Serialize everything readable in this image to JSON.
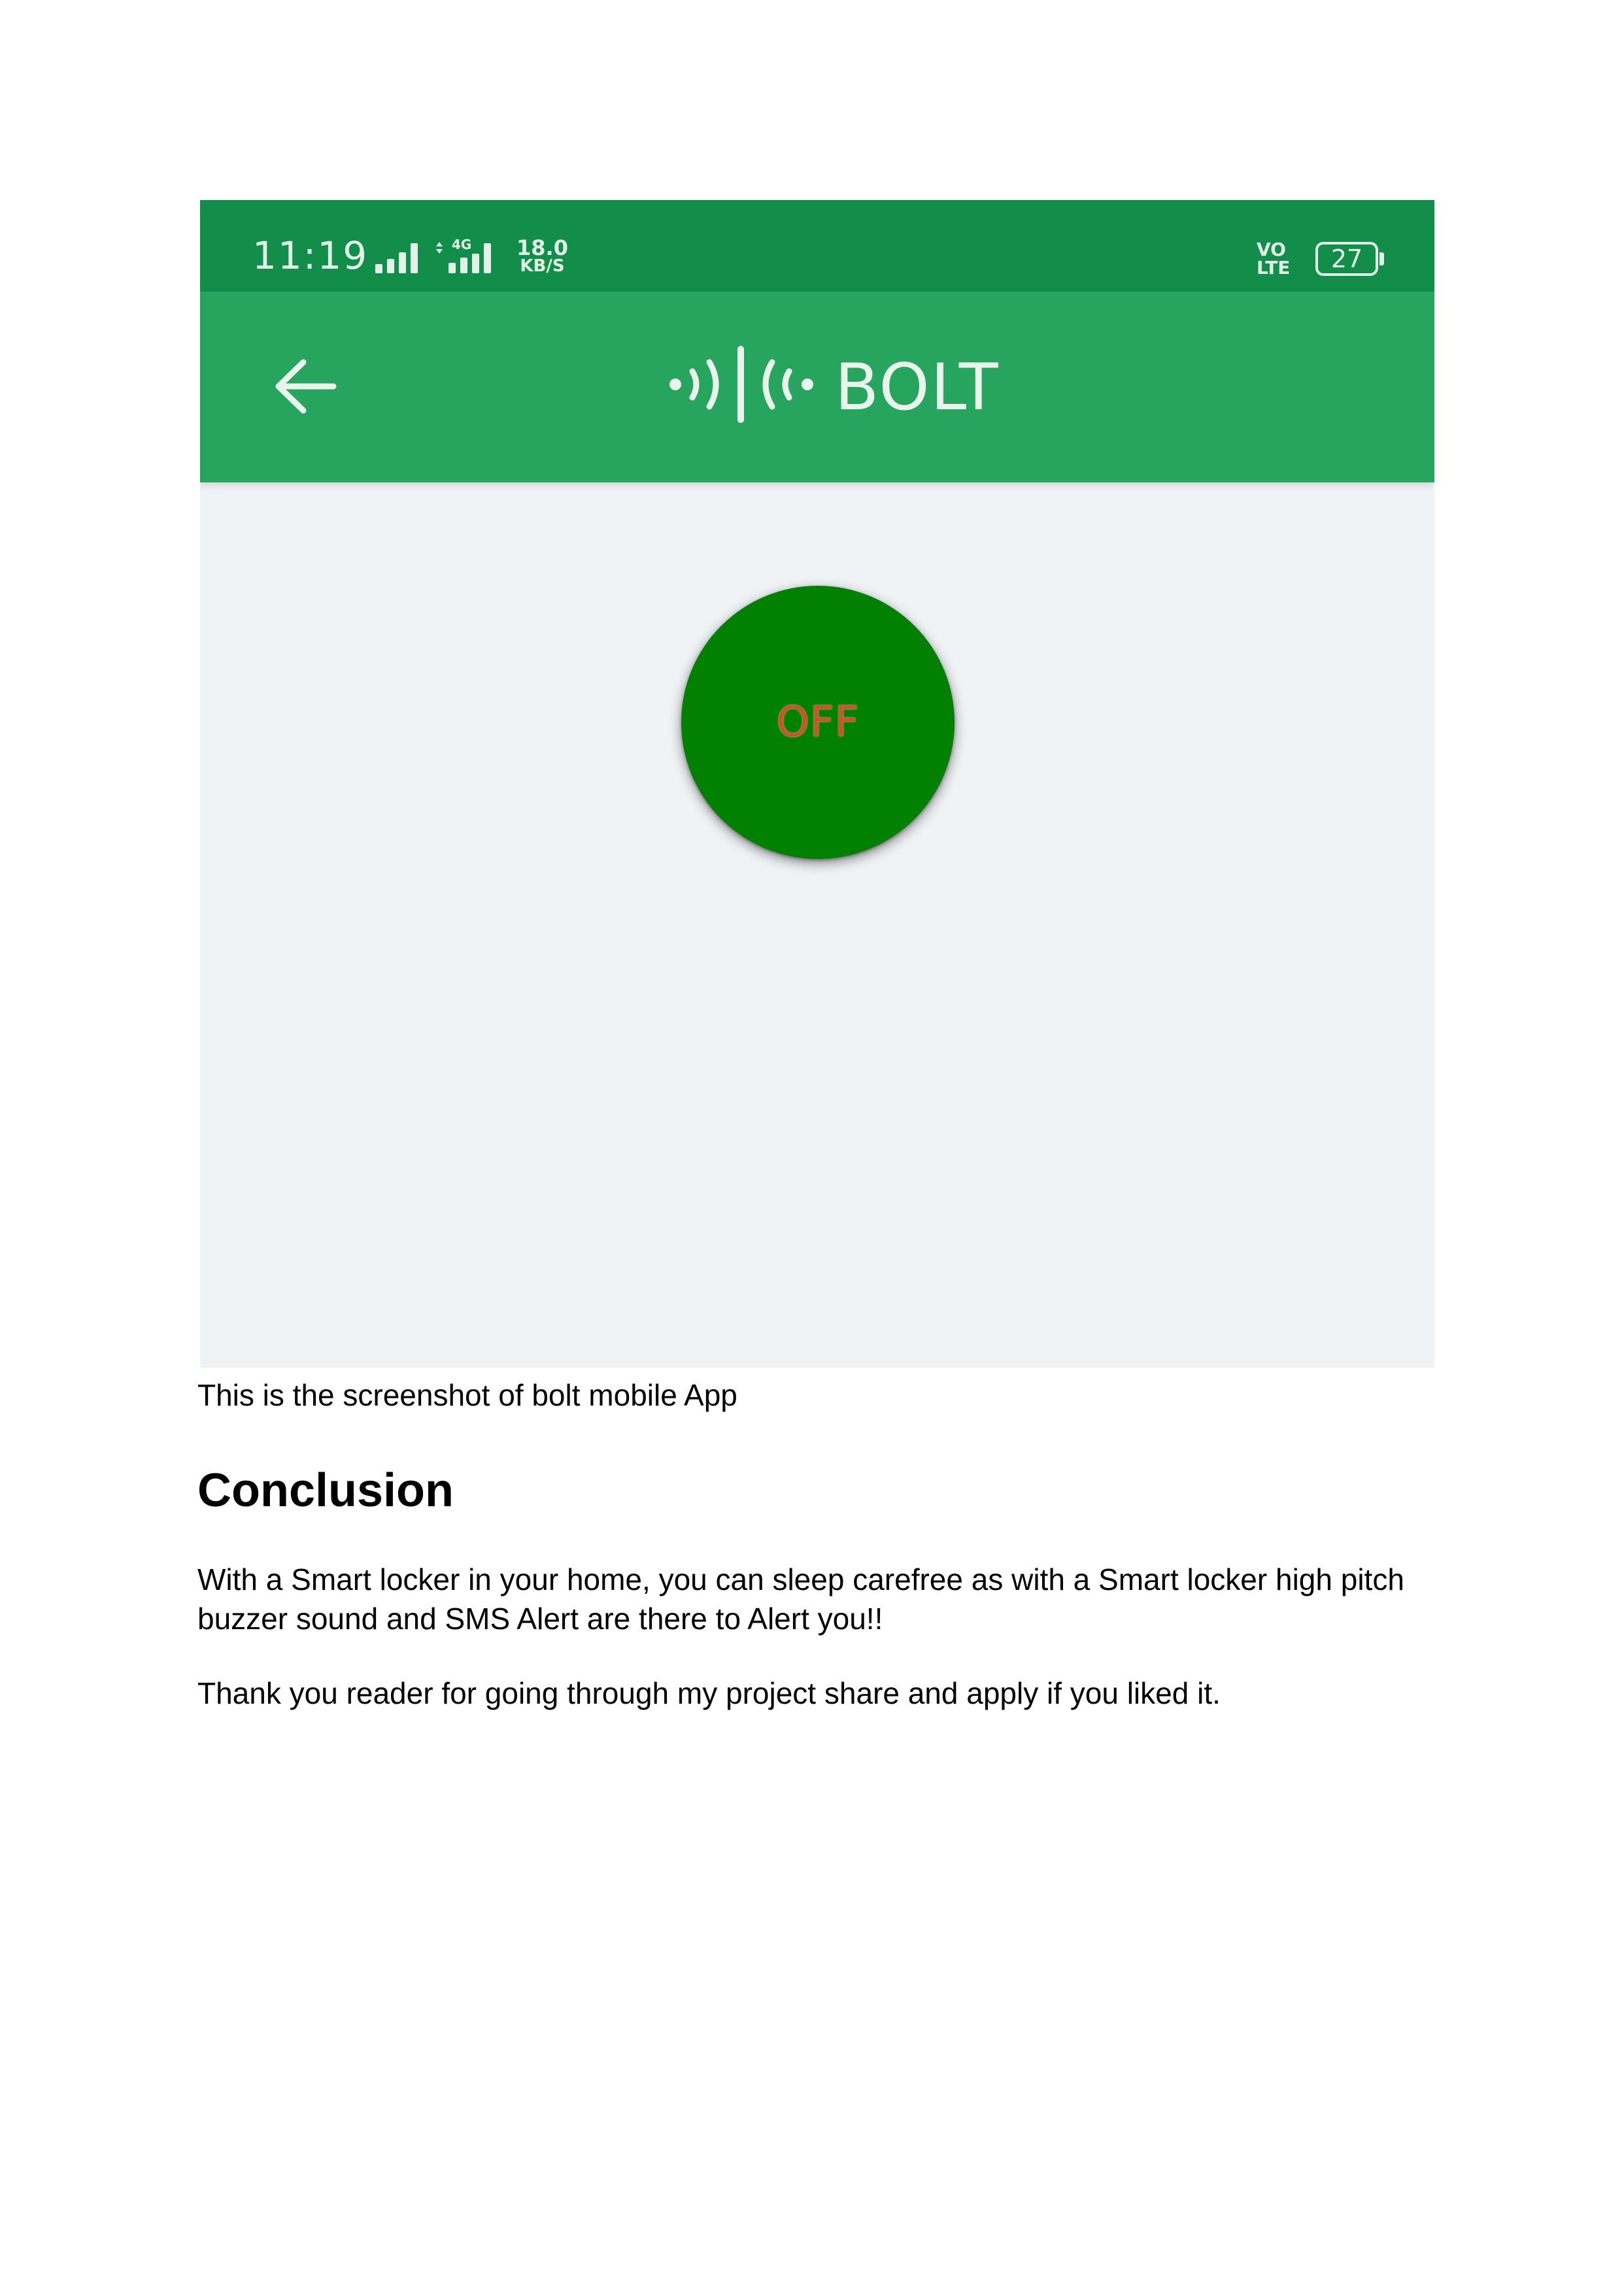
{
  "phone_screenshot": {
    "status_bar": {
      "time": "11:19",
      "network_label": "4G",
      "speed_value": "18.0",
      "speed_unit": "KB/S",
      "volte_top": "VO",
      "volte_bottom": "LTE",
      "battery_level": "27",
      "icons": [
        "signal-icon",
        "signal-4g-icon",
        "battery-icon"
      ]
    },
    "app_bar": {
      "back_icon": "arrow-left-icon",
      "brand_icon": "bolt-signal-logo-icon",
      "brand_name": "BOLT"
    },
    "toggle_button": {
      "label": "OFF"
    },
    "colors": {
      "status_bar": "#138d4a",
      "app_bar": "#27a55f",
      "background": "#eff3f6",
      "button": "#018001",
      "button_label": "#c9542c"
    }
  },
  "document": {
    "caption": "This is the screenshot of bolt mobile App",
    "heading": "Conclusion",
    "paragraphs": [
      "With a Smart locker in your home, you can sleep carefree as with a Smart locker high pitch buzzer sound and SMS Alert are there to Alert you!!",
      "Thank you reader for going through my project share and apply if you liked it."
    ]
  }
}
